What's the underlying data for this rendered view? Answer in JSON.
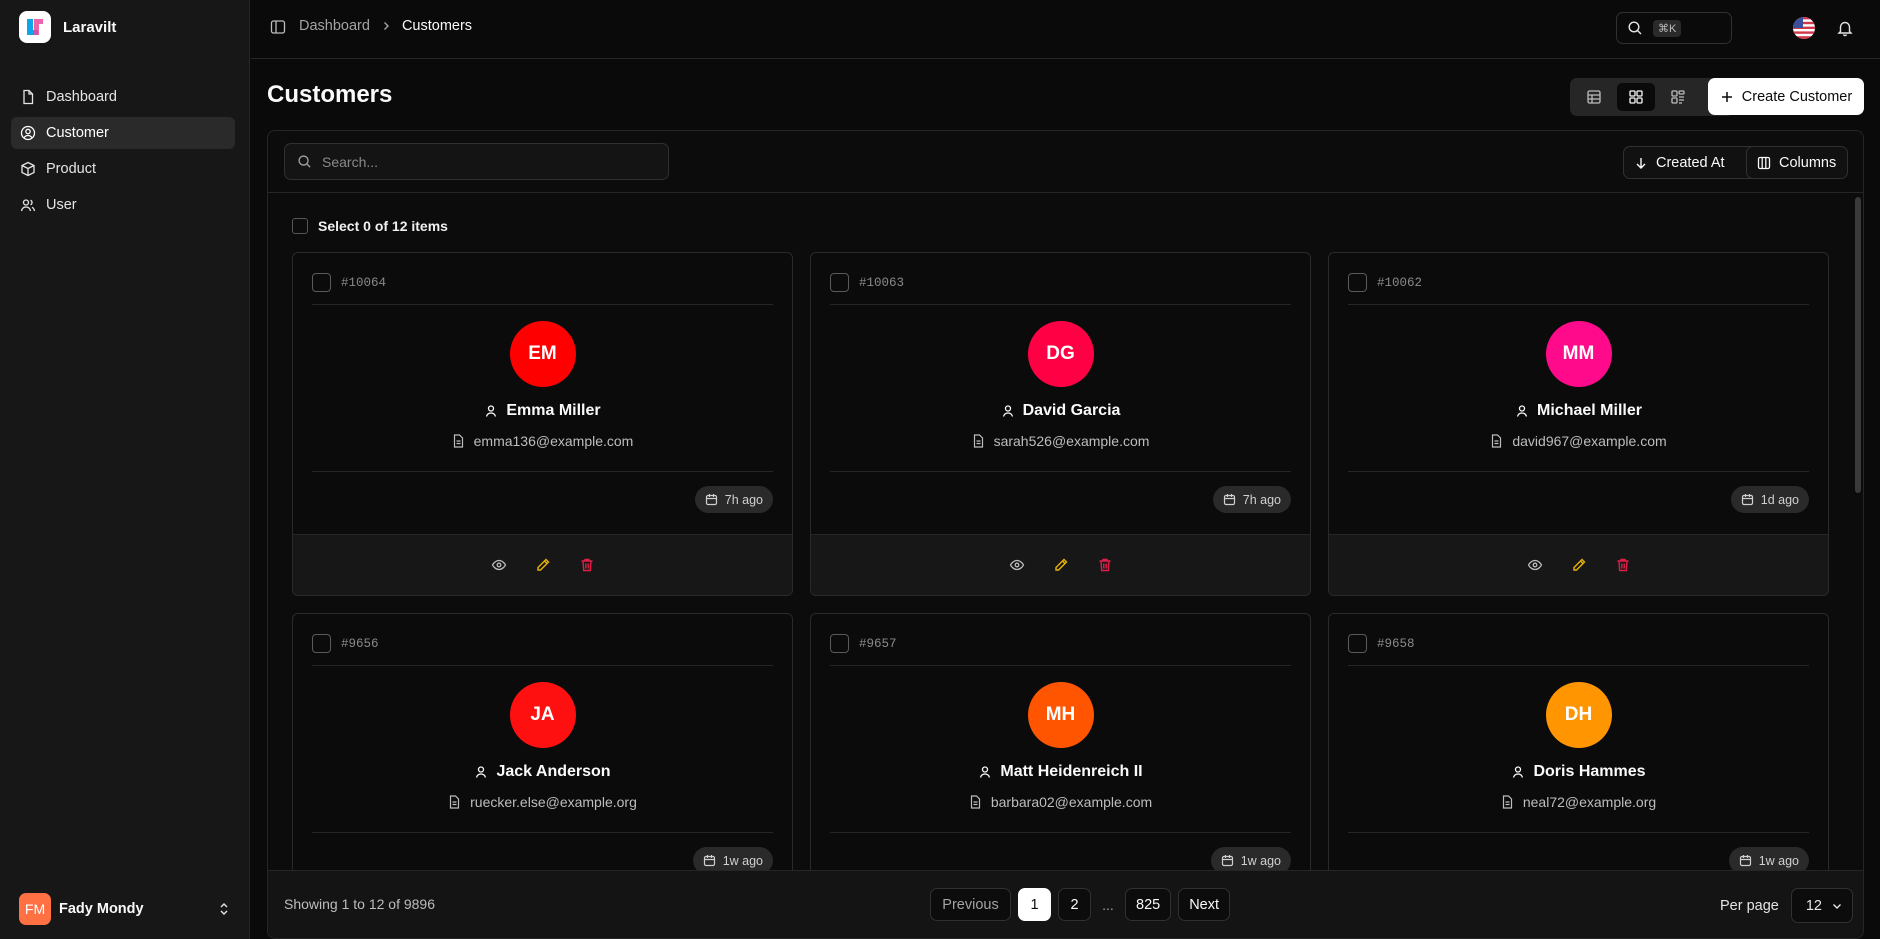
{
  "app": {
    "name": "Laravilt"
  },
  "sidebar": {
    "items": [
      {
        "label": "Dashboard",
        "icon": "file-icon",
        "active": false
      },
      {
        "label": "Customer",
        "icon": "user-circle-icon",
        "active": true
      },
      {
        "label": "Product",
        "icon": "box-icon",
        "active": false
      },
      {
        "label": "User",
        "icon": "users-icon",
        "active": false
      }
    ],
    "user": {
      "initials": "FM",
      "name": "Fady Mondy"
    }
  },
  "topbar": {
    "breadcrumbs": [
      "Dashboard",
      "Customers"
    ],
    "search_shortcut": "⌘K"
  },
  "page": {
    "title": "Customers",
    "create_label": "Create Customer"
  },
  "toolbar": {
    "search_placeholder": "Search...",
    "sort_label": "Created At",
    "columns_label": "Columns"
  },
  "selection": {
    "label": "Select 0 of 12 items"
  },
  "customers": [
    {
      "id": "#10064",
      "initials": "EM",
      "name": "Emma Miller",
      "email": "emma136@example.com",
      "created": "7h ago",
      "color": "#ff0000"
    },
    {
      "id": "#10063",
      "initials": "DG",
      "name": "David Garcia",
      "email": "sarah526@example.com",
      "created": "7h ago",
      "color": "#ff0044"
    },
    {
      "id": "#10062",
      "initials": "MM",
      "name": "Michael Miller",
      "email": "david967@example.com",
      "created": "1d ago",
      "color": "#ff0a8a"
    },
    {
      "id": "#9656",
      "initials": "JA",
      "name": "Jack Anderson",
      "email": "ruecker.else@example.org",
      "created": "1w ago",
      "color": "#ff1010"
    },
    {
      "id": "#9657",
      "initials": "MH",
      "name": "Matt Heidenreich II",
      "email": "barbara02@example.com",
      "created": "1w ago",
      "color": "#ff5500"
    },
    {
      "id": "#9658",
      "initials": "DH",
      "name": "Doris Hammes",
      "email": "neal72@example.org",
      "created": "1w ago",
      "color": "#ff9500"
    }
  ],
  "pagination": {
    "summary": "Showing 1 to 12 of 9896",
    "previous_label": "Previous",
    "next_label": "Next",
    "pages": [
      "1",
      "2",
      "825"
    ],
    "current_page": "1",
    "ellipsis": "...",
    "per_page_label": "Per page",
    "per_page_value": "12"
  },
  "colors": {
    "background": "#0a0a0a",
    "sidebar": "#171717",
    "delete": "#e11d48",
    "edit": "#eab308"
  }
}
